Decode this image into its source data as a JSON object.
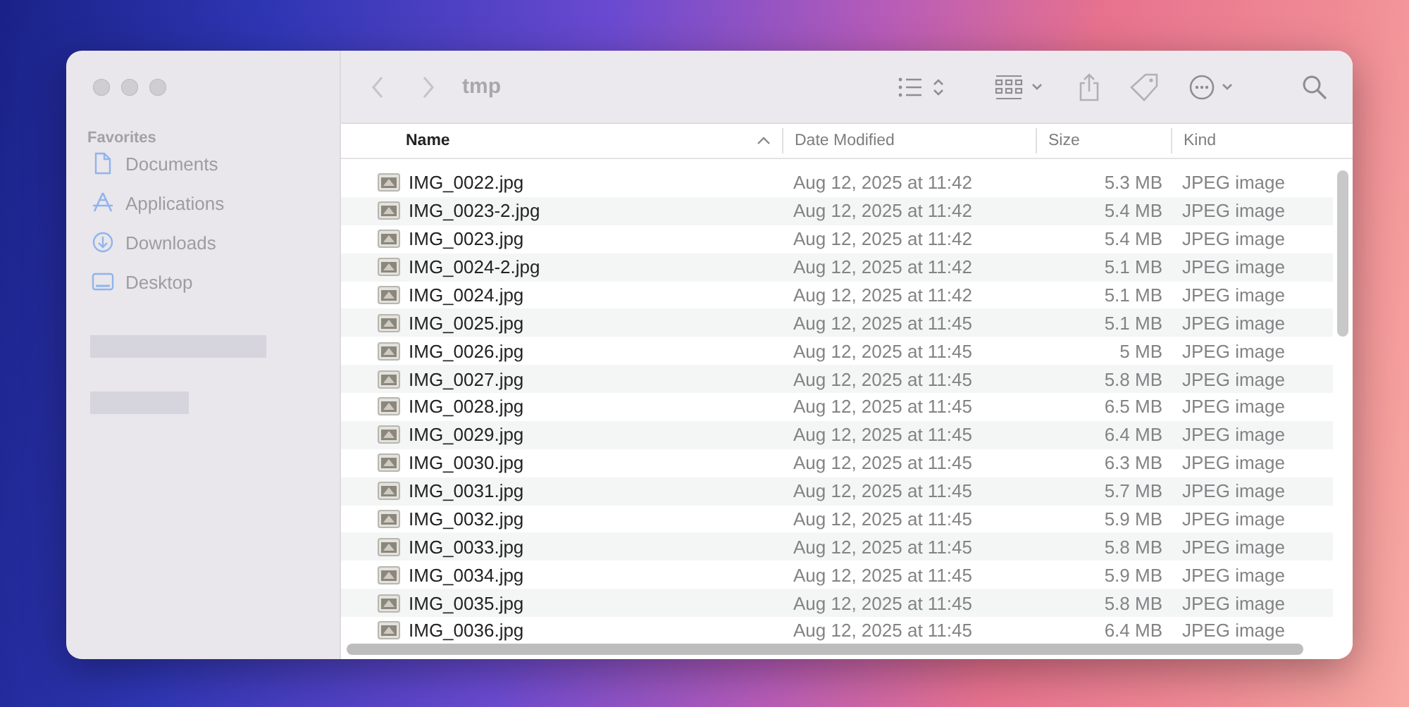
{
  "window": {
    "title": "tmp"
  },
  "sidebar": {
    "section": "Favorites",
    "items": [
      {
        "label": "Documents",
        "kind": "document"
      },
      {
        "label": "Applications",
        "kind": "applications"
      },
      {
        "label": "Downloads",
        "kind": "downloads"
      },
      {
        "label": "Desktop",
        "kind": "desktop"
      }
    ]
  },
  "table": {
    "columns": [
      {
        "label": "Name",
        "sorted": true
      },
      {
        "label": "Date Modified",
        "sorted": false
      },
      {
        "label": "Size",
        "sorted": false
      },
      {
        "label": "Kind",
        "sorted": false
      }
    ],
    "rows": [
      {
        "name": "IMG_0022.jpg",
        "date_modified": "Aug 12, 2025 at 11:42",
        "size": "5.3 MB",
        "kind": "JPEG image"
      },
      {
        "name": "IMG_0023-2.jpg",
        "date_modified": "Aug 12, 2025 at 11:42",
        "size": "5.4 MB",
        "kind": "JPEG image"
      },
      {
        "name": "IMG_0023.jpg",
        "date_modified": "Aug 12, 2025 at 11:42",
        "size": "5.4 MB",
        "kind": "JPEG image"
      },
      {
        "name": "IMG_0024-2.jpg",
        "date_modified": "Aug 12, 2025 at 11:42",
        "size": "5.1 MB",
        "kind": "JPEG image"
      },
      {
        "name": "IMG_0024.jpg",
        "date_modified": "Aug 12, 2025 at 11:42",
        "size": "5.1 MB",
        "kind": "JPEG image"
      },
      {
        "name": "IMG_0025.jpg",
        "date_modified": "Aug 12, 2025 at 11:45",
        "size": "5.1 MB",
        "kind": "JPEG image"
      },
      {
        "name": "IMG_0026.jpg",
        "date_modified": "Aug 12, 2025 at 11:45",
        "size": "5 MB",
        "kind": "JPEG image"
      },
      {
        "name": "IMG_0027.jpg",
        "date_modified": "Aug 12, 2025 at 11:45",
        "size": "5.8 MB",
        "kind": "JPEG image"
      },
      {
        "name": "IMG_0028.jpg",
        "date_modified": "Aug 12, 2025 at 11:45",
        "size": "6.5 MB",
        "kind": "JPEG image"
      },
      {
        "name": "IMG_0029.jpg",
        "date_modified": "Aug 12, 2025 at 11:45",
        "size": "6.4 MB",
        "kind": "JPEG image"
      },
      {
        "name": "IMG_0030.jpg",
        "date_modified": "Aug 12, 2025 at 11:45",
        "size": "6.3 MB",
        "kind": "JPEG image"
      },
      {
        "name": "IMG_0031.jpg",
        "date_modified": "Aug 12, 2025 at 11:45",
        "size": "5.7 MB",
        "kind": "JPEG image"
      },
      {
        "name": "IMG_0032.jpg",
        "date_modified": "Aug 12, 2025 at 11:45",
        "size": "5.9 MB",
        "kind": "JPEG image"
      },
      {
        "name": "IMG_0033.jpg",
        "date_modified": "Aug 12, 2025 at 11:45",
        "size": "5.8 MB",
        "kind": "JPEG image"
      },
      {
        "name": "IMG_0034.jpg",
        "date_modified": "Aug 12, 2025 at 11:45",
        "size": "5.9 MB",
        "kind": "JPEG image"
      },
      {
        "name": "IMG_0035.jpg",
        "date_modified": "Aug 12, 2025 at 11:45",
        "size": "5.8 MB",
        "kind": "JPEG image"
      },
      {
        "name": "IMG_0036.jpg",
        "date_modified": "Aug 12, 2025 at 11:45",
        "size": "6.4 MB",
        "kind": "JPEG image"
      }
    ]
  }
}
